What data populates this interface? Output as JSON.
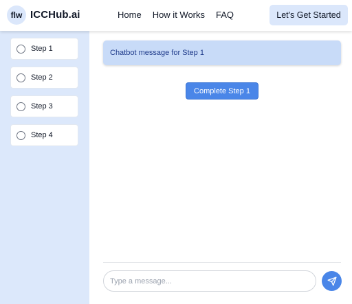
{
  "header": {
    "logo_badge": "flw",
    "logo_text": "ICCHub.ai",
    "nav": [
      {
        "label": "Home"
      },
      {
        "label": "How it Works"
      },
      {
        "label": "FAQ"
      }
    ],
    "cta_label": "Let's Get Started"
  },
  "sidebar": {
    "steps": [
      {
        "label": "Step 1",
        "checked": false
      },
      {
        "label": "Step 2",
        "checked": false
      },
      {
        "label": "Step 3",
        "checked": false
      },
      {
        "label": "Step 4",
        "checked": false
      }
    ]
  },
  "chat": {
    "bot_message": "Chatbot message for Step 1",
    "complete_button": "Complete Step 1",
    "input_placeholder": "Type a message...",
    "input_value": "",
    "send_icon": "send-icon"
  },
  "colors": {
    "accent": "#4a86e8",
    "sidebar_bg": "#dce8fb",
    "bot_bubble": "#c8dbf8"
  }
}
